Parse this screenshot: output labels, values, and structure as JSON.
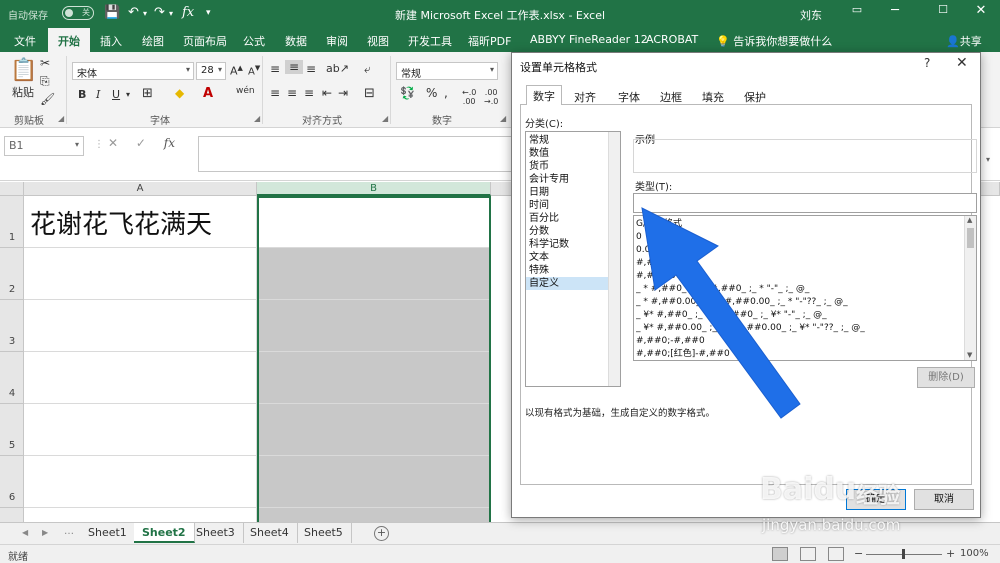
{
  "titlebar": {
    "autosave_label": "自动保存",
    "autosave_state": "关",
    "doc_title": "新建 Microsoft Excel 工作表.xlsx  -  Excel",
    "user": "刘东"
  },
  "ribbon_tabs": [
    {
      "label": "文件"
    },
    {
      "label": "开始"
    },
    {
      "label": "插入"
    },
    {
      "label": "绘图"
    },
    {
      "label": "页面布局"
    },
    {
      "label": "公式"
    },
    {
      "label": "数据"
    },
    {
      "label": "审阅"
    },
    {
      "label": "视图"
    },
    {
      "label": "开发工具"
    },
    {
      "label": "福昕PDF"
    },
    {
      "label": "ABBYY FineReader 12"
    },
    {
      "label": "ACROBAT"
    }
  ],
  "tell_me": "告诉我你想要做什么",
  "share": "共享",
  "ribbon": {
    "paste_label": "粘贴",
    "font_name": "宋体",
    "font_size": "28",
    "number_format": "常规",
    "groups": {
      "clipboard": "剪贴板",
      "font": "字体",
      "alignment": "对齐方式",
      "number": "数字"
    }
  },
  "formula_bar": {
    "name_box": "B1",
    "fx": "fx",
    "content": ""
  },
  "grid": {
    "columns": [
      "A",
      "B"
    ],
    "rows": [
      "1",
      "2",
      "3",
      "4",
      "5",
      "6"
    ],
    "a1_value": "花谢花飞花满天"
  },
  "sheets": [
    "Sheet1",
    "Sheet2",
    "Sheet3",
    "Sheet4",
    "Sheet5"
  ],
  "active_sheet": "Sheet2",
  "status": {
    "text": "就绪",
    "zoom": "100%"
  },
  "dialog": {
    "title": "设置单元格格式",
    "help": "?",
    "tabs": [
      "数字",
      "对齐",
      "字体",
      "边框",
      "填充",
      "保护"
    ],
    "active_tab": "数字",
    "category_label": "分类(C):",
    "categories": [
      "常规",
      "数值",
      "货币",
      "会计专用",
      "日期",
      "时间",
      "百分比",
      "分数",
      "科学记数",
      "文本",
      "特殊",
      "自定义"
    ],
    "selected_category": "自定义",
    "sample_label": "示例",
    "type_label": "类型(T):",
    "type_value": "",
    "type_list": [
      "G/通用格式",
      "0",
      "0.00",
      "#,##0",
      "#,##0.00",
      "_ * #,##0_ ;_ * -#,##0_ ;_ * \"-\"_ ;_ @_",
      "_ * #,##0.00_ ;_ * -#,##0.00_ ;_ * \"-\"??_ ;_ @_",
      "_ ¥* #,##0_ ;_ ¥* -#,##0_ ;_ ¥* \"-\"_ ;_ @_",
      "_ ¥* #,##0.00_ ;_ ¥* -#,##0.00_ ;_ ¥* \"-\"??_ ;_ @_",
      "#,##0;-#,##0",
      "#,##0;[红色]-#,##0"
    ],
    "delete_label": "删除(D)",
    "hint": "以现有格式为基础，生成自定义的数字格式。",
    "ok_label": "确定",
    "cancel_label": "取消"
  },
  "watermark": {
    "brand": "Baidu",
    "brand_suffix": "经验",
    "url": "jingyan.baidu.com"
  },
  "colors": {
    "excel_green": "#217346",
    "arrow_blue": "#1f6fe8",
    "selection_gray": "#c8c8c8"
  }
}
